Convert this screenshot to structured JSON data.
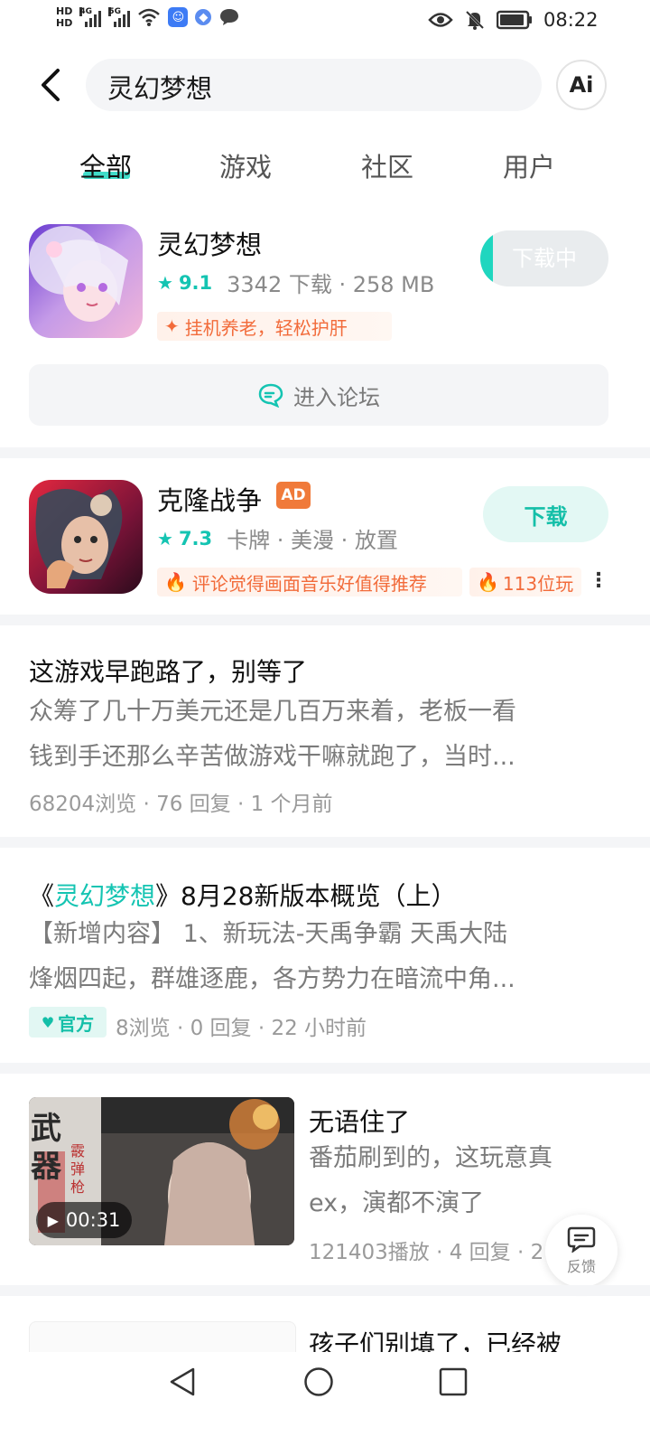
{
  "status_bar": {
    "hd1": "HD",
    "hd2": "HD",
    "net1": "4G",
    "net2": "5G",
    "time": "08:22"
  },
  "search": {
    "query": "灵幻梦想",
    "ai_label": "Ai"
  },
  "tabs": [
    {
      "label": "全部",
      "active": true
    },
    {
      "label": "游戏",
      "active": false
    },
    {
      "label": "社区",
      "active": false
    },
    {
      "label": "用户",
      "active": false
    }
  ],
  "apps": [
    {
      "name": "灵幻梦想",
      "rating": "9.1",
      "meta": "3342 下载 · 258 MB",
      "tags": [
        "挂机养老，轻松护肝"
      ],
      "button": "下载中",
      "download_progress": 0.1,
      "forum_button": "进入论坛"
    },
    {
      "name": "克隆战争",
      "ad_badge": "AD",
      "rating": "7.3",
      "meta": "卡牌 · 美漫 · 放置",
      "tags": [
        "评论觉得画面音乐好值得推荐",
        "113位玩"
      ],
      "button": "下载"
    }
  ],
  "posts": [
    {
      "title": "这游戏早跑路了，别等了",
      "body_lines": [
        "众筹了几十万美元还是几百万来着，老板一看",
        "钱到手还那么辛苦做游戏干嘛就跑了，当时..."
      ],
      "meta": "68204浏览 · 76 回复 · 1 个月前"
    },
    {
      "title_prefix": "《",
      "title_keyword": "灵幻梦想",
      "title_suffix": "》8月28新版本概览（上）",
      "body_lines": [
        "【新增内容】 1、新玩法-天禹争霸   天禹大陆",
        "烽烟四起，群雄逐鹿，各方势力在暗流中角..."
      ],
      "badge": "官方",
      "meta": "8浏览 · 0 回复 · 22 小时前"
    },
    {
      "title": "无语住了",
      "body_lines": [
        "番茄刷到的，这玩意真",
        "ex，演都不演了"
      ],
      "meta": "121403播放 · 4 回复 · 2",
      "video_duration": "00:31",
      "thumb_text": [
        "武",
        "器",
        "霰",
        "弹",
        "枪"
      ]
    },
    {
      "title": "孩子们别填了，已经被"
    }
  ],
  "feedback_label": "反馈",
  "colors": {
    "accent": "#1fd6bf",
    "tag_orange": "#f26b3a",
    "ad_orange": "#f07a3a"
  }
}
